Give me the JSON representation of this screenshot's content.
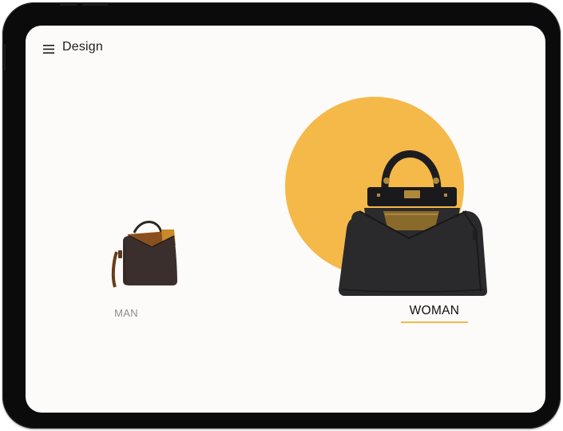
{
  "header": {
    "menu_icon": "hamburger-menu-icon",
    "title": "Design"
  },
  "categories": [
    {
      "label": "MAN",
      "selected": false,
      "image": "man-bag-image"
    },
    {
      "label": "WOMAN",
      "selected": true,
      "image": "woman-bag-image"
    }
  ],
  "colors": {
    "accent": "#f5b94a",
    "screen_bg": "#fcfbf9",
    "device_frame": "#0b0b0b",
    "text_primary": "#111111",
    "text_muted": "#8d8d8d"
  }
}
